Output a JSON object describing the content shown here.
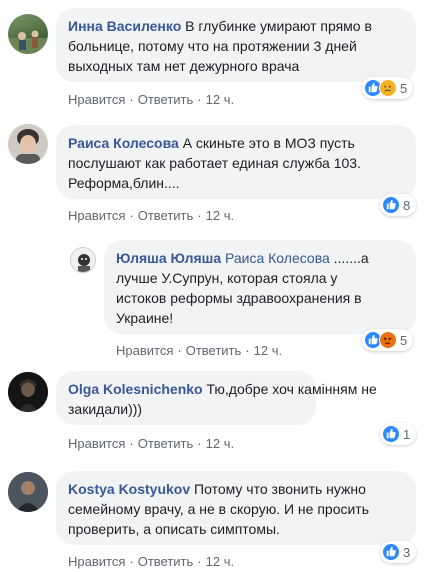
{
  "comments": [
    {
      "author": "Инна Василенко",
      "text_lines": [
        "В глубинке умирают прямо в",
        "больнице, потому что на протяжении 3 дней",
        "выходных там нет дежурного врача"
      ],
      "like_label": "Нравится",
      "reply_label": "Ответить",
      "time": "12 ч.",
      "reaction_count": "5",
      "reactions": [
        "like-icon",
        "sad-icon"
      ]
    },
    {
      "author": "Раиса Колесова",
      "text_lines": [
        "А скиньте это в МОЗ пусть",
        "послушают как работает единая служба 103.",
        "Реформа,блин...."
      ],
      "like_label": "Нравится",
      "reply_label": "Ответить",
      "time": "12 ч.",
      "reaction_count": "8",
      "reactions": [
        "like-icon"
      ]
    },
    {
      "author": "Юляша Юляша",
      "mention": "Раиса Колесова",
      "text_lines": [
        ".......а",
        "лучше У.Супрун, которая стояла у",
        "истоков реформы здравоохранения в",
        "Украине!"
      ],
      "like_label": "Нравится",
      "reply_label": "Ответить",
      "time": "12 ч.",
      "reaction_count": "5",
      "reactions": [
        "like-icon",
        "angry-icon"
      ]
    },
    {
      "author": "Olga Kolesnichenko",
      "text_lines": [
        "Тю,добре хоч камінням не",
        "закидали)))"
      ],
      "like_label": "Нравится",
      "reply_label": "Ответить",
      "time": "12 ч.",
      "reaction_count": "1",
      "reactions": [
        "like-icon"
      ]
    },
    {
      "author": "Kostya Kostyukov",
      "text_lines": [
        "Потому что звонить нужно",
        "семейному врачу, а не в скорую. И не просить",
        "проверить, а описать симптомы."
      ],
      "like_label": "Нравится",
      "reply_label": "Ответить",
      "time": "12 ч.",
      "reaction_count": "3",
      "reactions": [
        "like-icon"
      ]
    }
  ],
  "colors": {
    "author": "#385898",
    "bubble": "#f2f3f5",
    "meta": "#606770",
    "like": "#2d88ff",
    "sad": "#f7b125",
    "angry": "#e9710f"
  }
}
